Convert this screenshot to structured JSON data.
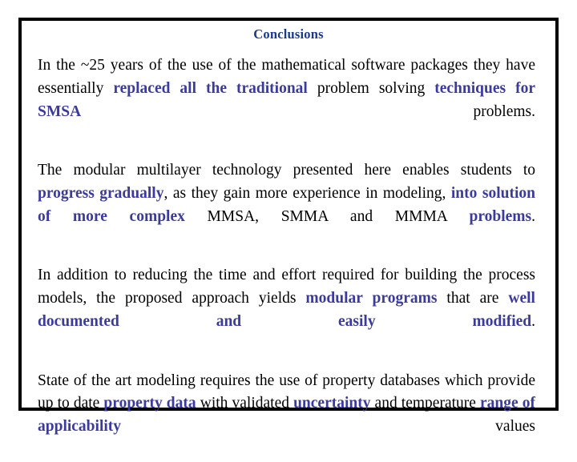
{
  "slide": {
    "title": "Conclusions",
    "title_color": "#1a3a8f",
    "frame_color": "#000000",
    "background_color": "#ffffff",
    "body_color": "#000000",
    "highlight_color": "#3b3b9e",
    "paragraphs": [
      {
        "id": "paragraph-1",
        "plain_text": "In the ~25 years of the use of the mathematical software packages they have essentially replaced all the traditional problem solving techniques for SMSA problems.",
        "runs": [
          {
            "text": "In the ~25 years of the use of the mathematical software packages they have essentially ",
            "highlight": false
          },
          {
            "text": "replaced all the traditional",
            "highlight": true
          },
          {
            "text": " problem solving ",
            "highlight": false
          },
          {
            "text": "techniques for SMSA",
            "highlight": true
          },
          {
            "text": " problems.",
            "highlight": false
          }
        ]
      },
      {
        "id": "paragraph-2",
        "plain_text": "The modular multilayer technology presented here enables students to progress gradually, as they gain more experience in modeling, into solution of more complex MMSA, SMMA and MMMA problems.",
        "runs": [
          {
            "text": "The modular multilayer technology presented here enables students to ",
            "highlight": false
          },
          {
            "text": "progress gradually",
            "highlight": true
          },
          {
            "text": ", as they gain more experience in modeling, ",
            "highlight": false
          },
          {
            "text": "into solution of more complex",
            "highlight": true
          },
          {
            "text": " MMSA, SMMA and MMMA ",
            "highlight": false
          },
          {
            "text": "problems",
            "highlight": true
          },
          {
            "text": ".",
            "highlight": false
          }
        ]
      },
      {
        "id": "paragraph-3",
        "plain_text": "In addition to reducing the time and effort required for building the process models, the proposed approach yields modular programs that are well documented and easily modified.",
        "runs": [
          {
            "text": "In addition to reducing the time and effort required for building the process models, the proposed approach yields ",
            "highlight": false
          },
          {
            "text": "modular programs",
            "highlight": true
          },
          {
            "text": " that are ",
            "highlight": false
          },
          {
            "text": "well documented and easily modified",
            "highlight": true
          },
          {
            "text": ".",
            "highlight": false
          }
        ]
      },
      {
        "id": "paragraph-4",
        "plain_text": "State of the art modeling requires the use of property databases which provide up to date property data with validated uncertainty and temperature range of applicability values",
        "runs": [
          {
            "text": "State of the art modeling requires the use of property databases which provide up to date ",
            "highlight": false
          },
          {
            "text": "property data",
            "highlight": true
          },
          {
            "text": " with validated ",
            "highlight": false
          },
          {
            "text": "uncertainty",
            "highlight": true
          },
          {
            "text": " and temperature ",
            "highlight": false
          },
          {
            "text": "range of applicability",
            "highlight": true
          },
          {
            "text": " values",
            "highlight": false
          }
        ]
      }
    ]
  }
}
